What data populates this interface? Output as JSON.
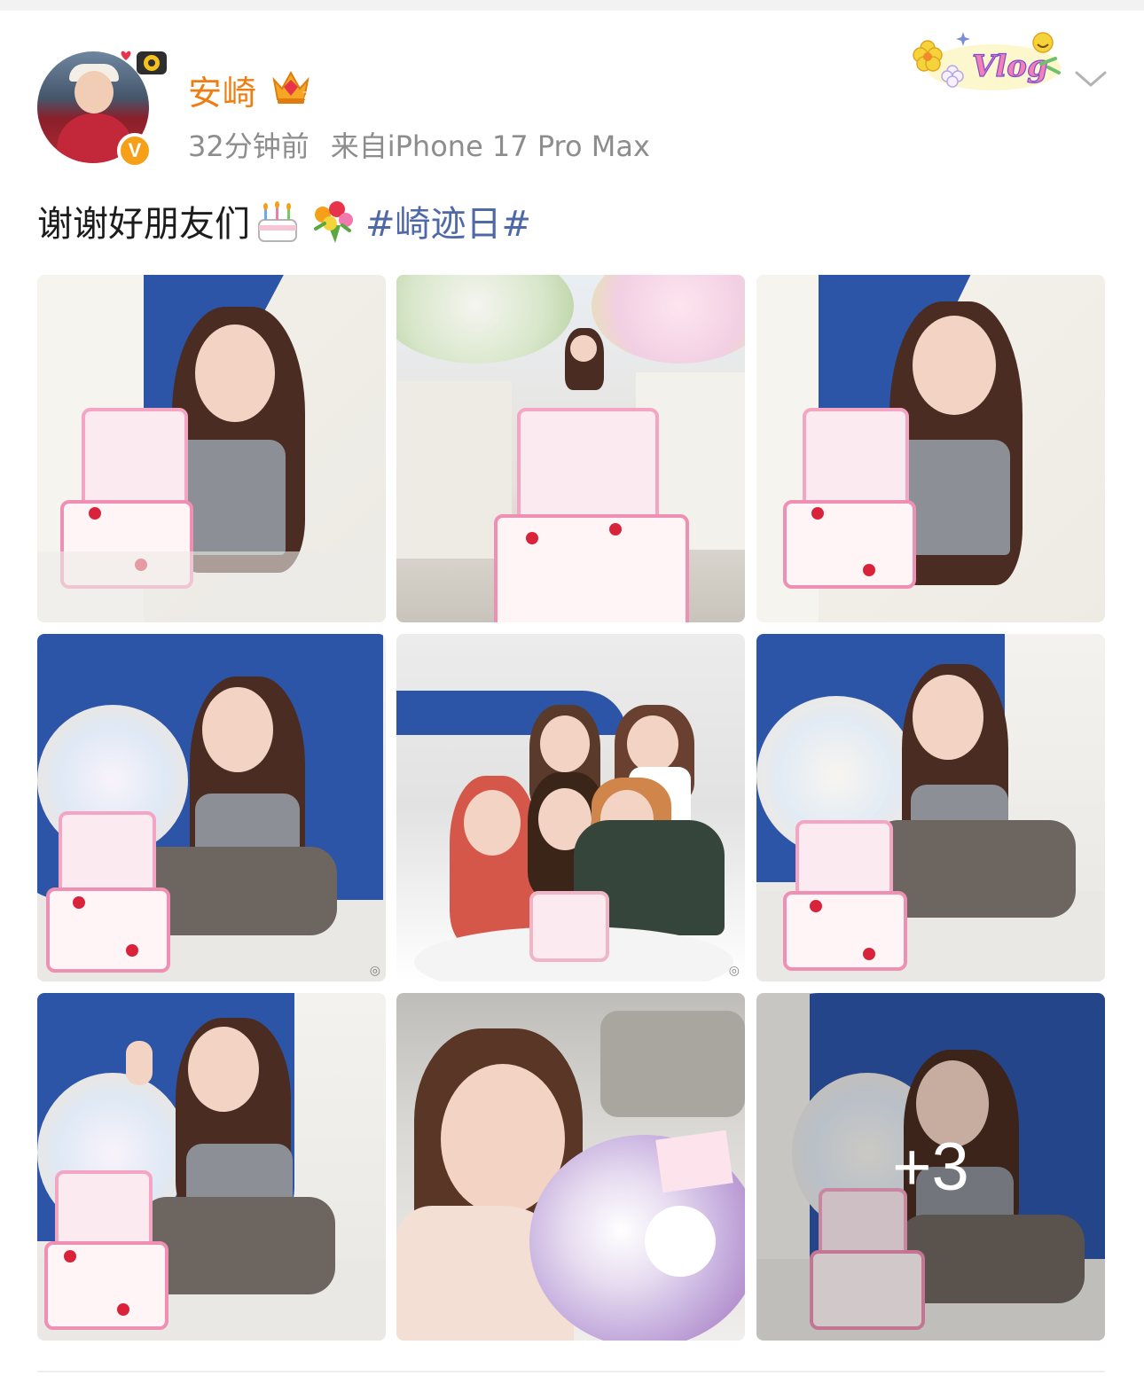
{
  "post": {
    "author": {
      "name": "安崎",
      "verified_badge": "V",
      "avatar_icon": "avatar-photo",
      "level_icon": "crown-icon"
    },
    "time": "32分钟前",
    "source": "来自iPhone 17 Pro Max",
    "text": {
      "body": "谢谢好朋友们",
      "emoji": [
        "birthday-cake-emoji",
        "bouquet-emoji"
      ],
      "hashtag": "#崎迹日#"
    },
    "sticker": "Vlog",
    "menu_icon": "chevron-down-icon",
    "images": {
      "count_more": "+3",
      "items": [
        {
          "name": "photo-girl-holding-cake"
        },
        {
          "name": "photo-cake-closeup"
        },
        {
          "name": "photo-girl-laughing-with-cake"
        },
        {
          "name": "photo-girl-sitting-with-cake"
        },
        {
          "name": "photo-group-friends"
        },
        {
          "name": "photo-girl-kneeling-with-cake"
        },
        {
          "name": "photo-girl-waving-with-cake"
        },
        {
          "name": "photo-selfie-with-flowers"
        },
        {
          "name": "photo-girl-smiling-more"
        }
      ]
    }
  },
  "colors": {
    "username": "#f07d12",
    "meta": "#8d8d8d",
    "hashtag": "#4f68a8",
    "badge": "#f6a019"
  }
}
